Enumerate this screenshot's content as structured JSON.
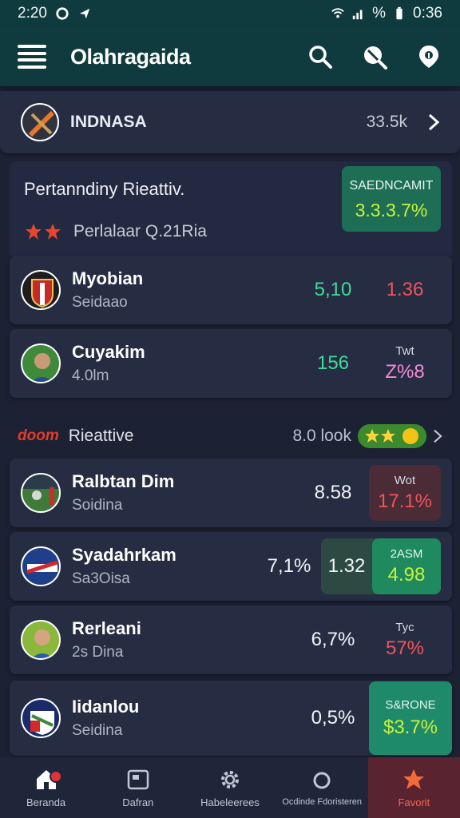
{
  "status_bar": {
    "time": "2:20",
    "battery_text": "%",
    "clock_right": "0:36"
  },
  "app_bar": {
    "title": "Olahragaida"
  },
  "featured": {
    "name": "INDNASA",
    "count": "33.5k"
  },
  "group": {
    "title": "Pertanndiny Rieattiv.",
    "subtitle": "Perlalaar Q.21Ria",
    "badge_label": "SAEDNCAMIT",
    "badge_value": "3.3.3.7%"
  },
  "rows_top": [
    {
      "name": "Myobian",
      "sub": "Seidaao",
      "val1": "5,10",
      "val2": "1.36"
    },
    {
      "name": "Cuyakim",
      "sub": "4.0lm",
      "val1": "156",
      "val2_label": "Twt",
      "val2": "Z%8"
    }
  ],
  "section": {
    "brand": "doom",
    "title": "Rieattive",
    "count": "8.0 look"
  },
  "rows_bottom": [
    {
      "name": "Ralbtan Dim",
      "sub": "Soidina",
      "val1": "8.58",
      "val2_label": "Wot",
      "val2": "17.1%"
    },
    {
      "name": "Syadahrkam",
      "sub": "Sa3Oisa",
      "val0": "7,1%",
      "val1": "1.32",
      "val2_label": "2ASM",
      "val2": "4.98"
    },
    {
      "name": "Rerleani",
      "sub": "2s Dina",
      "val1": "6,7%",
      "val2_label": "Tyc",
      "val2": "57%"
    },
    {
      "name": "Iidanlou",
      "sub": "Seidina",
      "val1": "0,5%",
      "val2_label": "S&RONE",
      "val2": "$3.7%"
    }
  ],
  "bottom_nav": [
    {
      "label": "Beranda"
    },
    {
      "label": "Dafran"
    },
    {
      "label": "Habeleerees"
    },
    {
      "label": "Ocdinde Fdoristeren"
    },
    {
      "label": "Favorit"
    }
  ],
  "colors": {
    "accent_teal": "#0f3b3e",
    "positive": "#3ddc9a",
    "negative": "#f0545a",
    "badge_green": "#1e6e55"
  }
}
